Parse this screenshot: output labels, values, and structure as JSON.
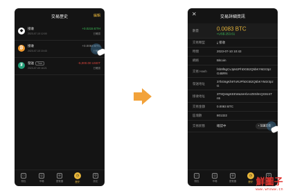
{
  "left_screen": {
    "title": "交易歷史",
    "edit_label": "編輯",
    "transactions": [
      {
        "coin": "ETH",
        "icon": "ethereum-icon",
        "name": "接收",
        "badge": "",
        "date": "2023-07-10 12:00",
        "amount": "+0.0215 ETH",
        "status": "已確認",
        "direction": "pos"
      },
      {
        "coin": "BTC",
        "icon": "bitcoin-icon",
        "name": "接收",
        "badge": "",
        "date": "2023-07-10 10:43",
        "amount": "+0.0083 BTC",
        "status": "已確認",
        "direction": "neutral"
      },
      {
        "coin": "USDT",
        "icon": "tether-icon",
        "name": "發送",
        "badge": "Tron",
        "date": "2023-07-09 18:21",
        "amount": "-5,000.00 USDT",
        "status": "已確認",
        "direction": "neg"
      }
    ],
    "nav": [
      {
        "label": "錢包",
        "icon": "wallet-icon",
        "glyph": "▭",
        "active": false
      },
      {
        "label": "市場",
        "icon": "market-icon",
        "glyph": "◎",
        "active": false
      },
      {
        "label": "瀏覽器",
        "icon": "browser-icon",
        "glyph": "⊕",
        "active": false
      },
      {
        "label": "歷史",
        "icon": "history-icon",
        "glyph": "◷",
        "active": true
      },
      {
        "label": "設定",
        "icon": "settings-icon",
        "glyph": "⚙",
        "active": false
      }
    ]
  },
  "right_screen": {
    "title": "交易詳細資訊",
    "close_glyph": "✕",
    "amount_label": "數量",
    "amount_value": "0.0083 BTC",
    "amount_usd": "≈US$ 253.61",
    "rows": [
      {
        "label": "交易類型",
        "value": "接收"
      },
      {
        "label": "時間",
        "value": "2023-07-10 10:43"
      },
      {
        "label": "網絡",
        "value": "Bitcoin"
      },
      {
        "label": "交易 Hash",
        "value": "f4b9f6gCvJpMJPhDGB2Q5bKYM2r3pzG4BRN"
      },
      {
        "label": "發送地址",
        "value": "37bG6gKh9TxRJPhDGB2Q5bKYM2r3pzG"
      },
      {
        "label": "接收地址",
        "value": "3T9Qs6gKEEWa2eHbArZE5hKQG8z4Tn5"
      },
      {
        "label": "交易金額",
        "value": "0.0083 BTC"
      },
      {
        "label": "區塊數",
        "value": "801322"
      }
    ],
    "status_label": "交易狀態",
    "status_value": "確認中",
    "status_button": "+ 加速交易",
    "nav": [
      {
        "label": "錢包",
        "icon": "wallet-icon",
        "glyph": "▭",
        "active": false
      },
      {
        "label": "市場",
        "icon": "market-icon",
        "glyph": "◎",
        "active": false
      },
      {
        "label": "瀏覽器",
        "icon": "browser-icon",
        "glyph": "⊕",
        "active": false
      },
      {
        "label": "歷史",
        "icon": "history-icon",
        "glyph": "◷",
        "active": true
      },
      {
        "label": "設定",
        "icon": "settings-icon",
        "glyph": "⚙",
        "active": false
      }
    ]
  },
  "watermark": {
    "main": "鮮圖子",
    "sub": "www.wnsww.cn"
  },
  "colors": {
    "accent": "#e7b53a",
    "positive": "#3ec15a",
    "negative": "#e0473f",
    "arrow": "#f2a23a",
    "watermark": "#e0342f"
  }
}
